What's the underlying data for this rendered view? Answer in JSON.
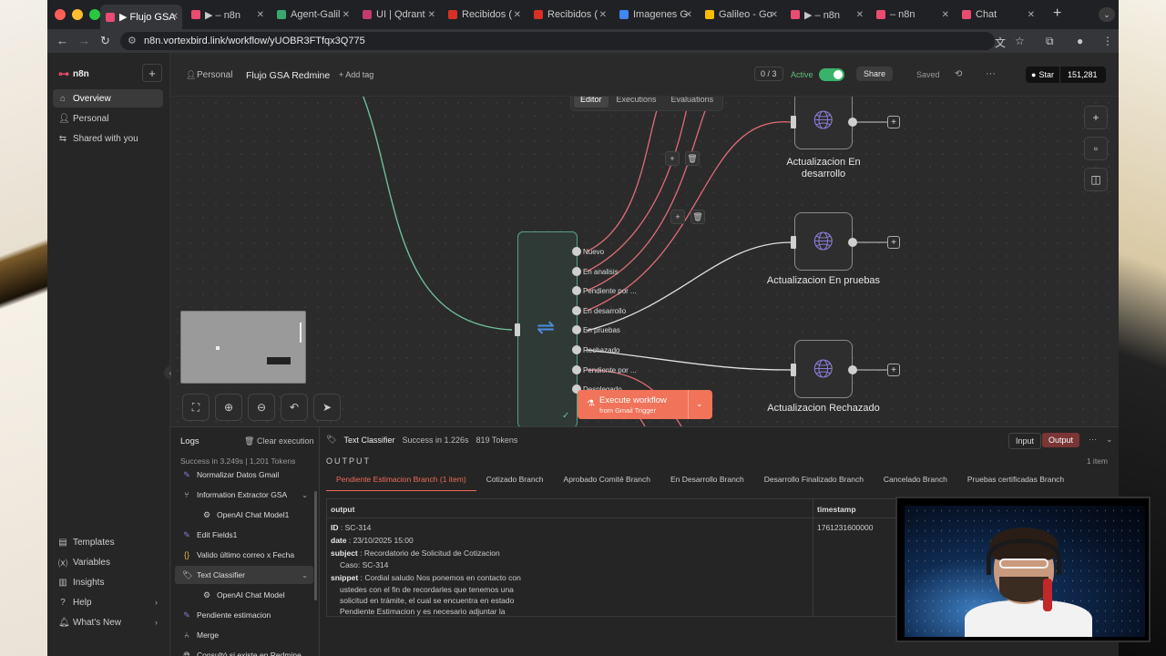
{
  "browser": {
    "tabs": [
      {
        "label": "▶ Flujo GSA",
        "color": "#ea4b71"
      },
      {
        "label": "▶ – n8n",
        "color": "#ea4b71"
      },
      {
        "label": "Agent-Galil",
        "color": "#3aa76d"
      },
      {
        "label": "UI | Qdrant",
        "color": "#c23b6b"
      },
      {
        "label": "Recibidos (",
        "color": "#d93025"
      },
      {
        "label": "Recibidos (",
        "color": "#d93025"
      },
      {
        "label": "Imagenes G",
        "color": "#4285f4"
      },
      {
        "label": "Galileo - Go",
        "color": "#fbbc04"
      },
      {
        "label": "▶ – n8n",
        "color": "#ea4b71"
      },
      {
        "label": "– n8n",
        "color": "#ea4b71"
      },
      {
        "label": "Chat",
        "color": "#ea4b71"
      }
    ],
    "url": "n8n.vortexbird.link/workflow/yUOBR3FTfqx3Q775"
  },
  "sidebar": {
    "brand": "n8n",
    "items": [
      {
        "label": "Overview",
        "icon": "home-icon"
      },
      {
        "label": "Personal",
        "icon": "user-icon"
      },
      {
        "label": "Shared with you",
        "icon": "share-icon"
      }
    ],
    "bottom": [
      {
        "label": "Templates",
        "icon": "template-icon"
      },
      {
        "label": "Variables",
        "icon": "variables-icon"
      },
      {
        "label": "Insights",
        "icon": "insights-icon"
      },
      {
        "label": "Help",
        "icon": "help-icon"
      },
      {
        "label": "What's New",
        "icon": "bell-icon"
      }
    ]
  },
  "header": {
    "project": "Personal",
    "workflow_name": "Flujo GSA Redmine",
    "add_tag": "+ Add tag",
    "counter": "0 / 3",
    "active_label": "Active",
    "share": "Share",
    "saved": "Saved",
    "star": "Star",
    "star_count": "151,281"
  },
  "canvas": {
    "modes": [
      "Editor",
      "Executions",
      "Evaluations"
    ],
    "branches": [
      "Nuevo",
      "En analisis",
      "Pendiente por ...",
      "En desarrollo",
      "En pruebas",
      "Rechazado",
      "Pendiente por ...",
      "Desplegado"
    ],
    "nodes": [
      {
        "label": "Actualizacion En desarrollo"
      },
      {
        "label": "Actualizacion En pruebas"
      },
      {
        "label": "Actualizacion Rechazado"
      }
    ],
    "execute": {
      "label": "Execute workflow",
      "sub": "from Gmail Trigger"
    },
    "colors": {
      "accent": "#ea4b71",
      "execute": "#f0735a",
      "active": "#39b36a",
      "green_edge": "#5aa08a"
    }
  },
  "logs": {
    "title": "Logs",
    "clear": "Clear execution",
    "summary": "Success in 3.249s  |  1,201 Tokens",
    "items": [
      {
        "label": "Normalizar Datos Gmail",
        "icon": "pencil-icon"
      },
      {
        "label": "Information Extractor GSA",
        "icon": "extractor-icon"
      },
      {
        "label": "OpenAI Chat Model1",
        "icon": "openai-icon"
      },
      {
        "label": "Edit Fields1",
        "icon": "pencil-icon"
      },
      {
        "label": "Valido último correo x Fecha",
        "icon": "braces-icon"
      },
      {
        "label": "Text Classifier",
        "icon": "tag-icon"
      },
      {
        "label": "OpenAI Chat Model",
        "icon": "openai-icon"
      },
      {
        "label": "Pendiente estimacion",
        "icon": "pencil-icon"
      },
      {
        "label": "Merge",
        "icon": "merge-icon"
      },
      {
        "label": "Consultó si existe en Redmine",
        "icon": "globe-icon"
      }
    ]
  },
  "detail": {
    "node": "Text Classifier",
    "status": "Success in 1.226s",
    "tokens": "819 Tokens",
    "input": "Input",
    "output": "Output",
    "output_label": "OUTPUT",
    "items_count": "1 item",
    "branch_tabs": [
      "Pendiente Estimacion Branch (1 item)",
      "Cotizado Branch",
      "Aprobado Comité Branch",
      "En Desarrollo Branch",
      "Desarrollo Finalizado Branch",
      "Cancelado Branch",
      "Pruebas certificadas Branch"
    ],
    "columns": [
      "output",
      "timestamp"
    ],
    "row": {
      "id_key": "ID",
      "id": "SC-314",
      "date_key": "date",
      "date": "23/10/2025 15:00",
      "subject_key": "subject",
      "subject": "Recordatorio de Solicitud de Cotizacion",
      "subject_2": "Caso: SC-314",
      "snippet_key": "snippet",
      "snippet_1": "Cordial saludo Nos ponemos en contacto con",
      "snippet_2": "ustedes con el fin de recordarles que tenemos una",
      "snippet_3": "solicitud en trámite, el cual se encuentra en estado",
      "snippet_4": "Pendiente Estimacion y es necesario adjuntar la",
      "timestamp": "1761231600000"
    }
  }
}
